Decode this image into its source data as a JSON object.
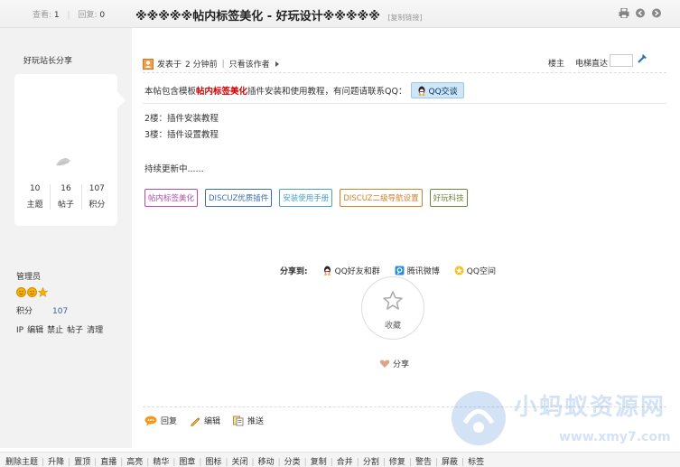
{
  "topbar": {
    "views_label": "查看:",
    "views": "1",
    "replies_label": "回复:",
    "replies": "0",
    "title": "※※※※※帖内标签美化 - 好玩设计※※※※※",
    "copy_link": "[复制链接]"
  },
  "author": {
    "name": "好玩站长分享",
    "stats": [
      {
        "value": "10",
        "label": "主题"
      },
      {
        "value": "16",
        "label": "帖子"
      },
      {
        "value": "107",
        "label": "积分"
      }
    ],
    "role": "管理员",
    "points_label": "积分",
    "points_value": "107",
    "admin_links": [
      "IP",
      "编辑",
      "禁止",
      "帖子",
      "清理"
    ]
  },
  "post": {
    "posted_prefix": "发表于",
    "posted_time": "2 分钟前",
    "only_author": "只看该作者",
    "floor": "楼主",
    "jump_label": "电梯直达",
    "intro_before": "本帖包含模板",
    "intro_highlight": "帖内标签美化",
    "intro_after": "插件安装和使用教程，有问题请联系QQ：",
    "qq_button": "QQ交谈",
    "line1": "2楼：插件安装教程",
    "line2": "3楼：插件设置教程",
    "line3": "持续更新中......",
    "tags": [
      {
        "text": "帖内标签美化",
        "color": "#b04da8"
      },
      {
        "text": "DISCUZ优质插件",
        "color": "#3a6ea8"
      },
      {
        "text": "安装使用手册",
        "color": "#4aa0c8"
      },
      {
        "text": "DISCUZ二级导航设置",
        "color": "#d0802a"
      },
      {
        "text": "好玩科技",
        "color": "#6a8a3a"
      }
    ],
    "share_label": "分享到:",
    "share_targets": [
      "QQ好友和群",
      "腾讯微博",
      "QQ空间"
    ],
    "favorite": "收藏",
    "share": "分享",
    "actions": [
      "回复",
      "编辑",
      "推送"
    ]
  },
  "mod_links": [
    "删除主题",
    "升降",
    "置顶",
    "直播",
    "高亮",
    "精华",
    "图章",
    "图标",
    "关闭",
    "移动",
    "分类",
    "复制",
    "合并",
    "分割",
    "修复",
    "警告",
    "屏蔽",
    "标签"
  ],
  "watermark": {
    "text": "小蚂蚁资源网",
    "url": "www.xmy7.com"
  },
  "colors": {
    "accent": "#c00",
    "link": "#369",
    "left_bg": "#f2f2f2"
  }
}
